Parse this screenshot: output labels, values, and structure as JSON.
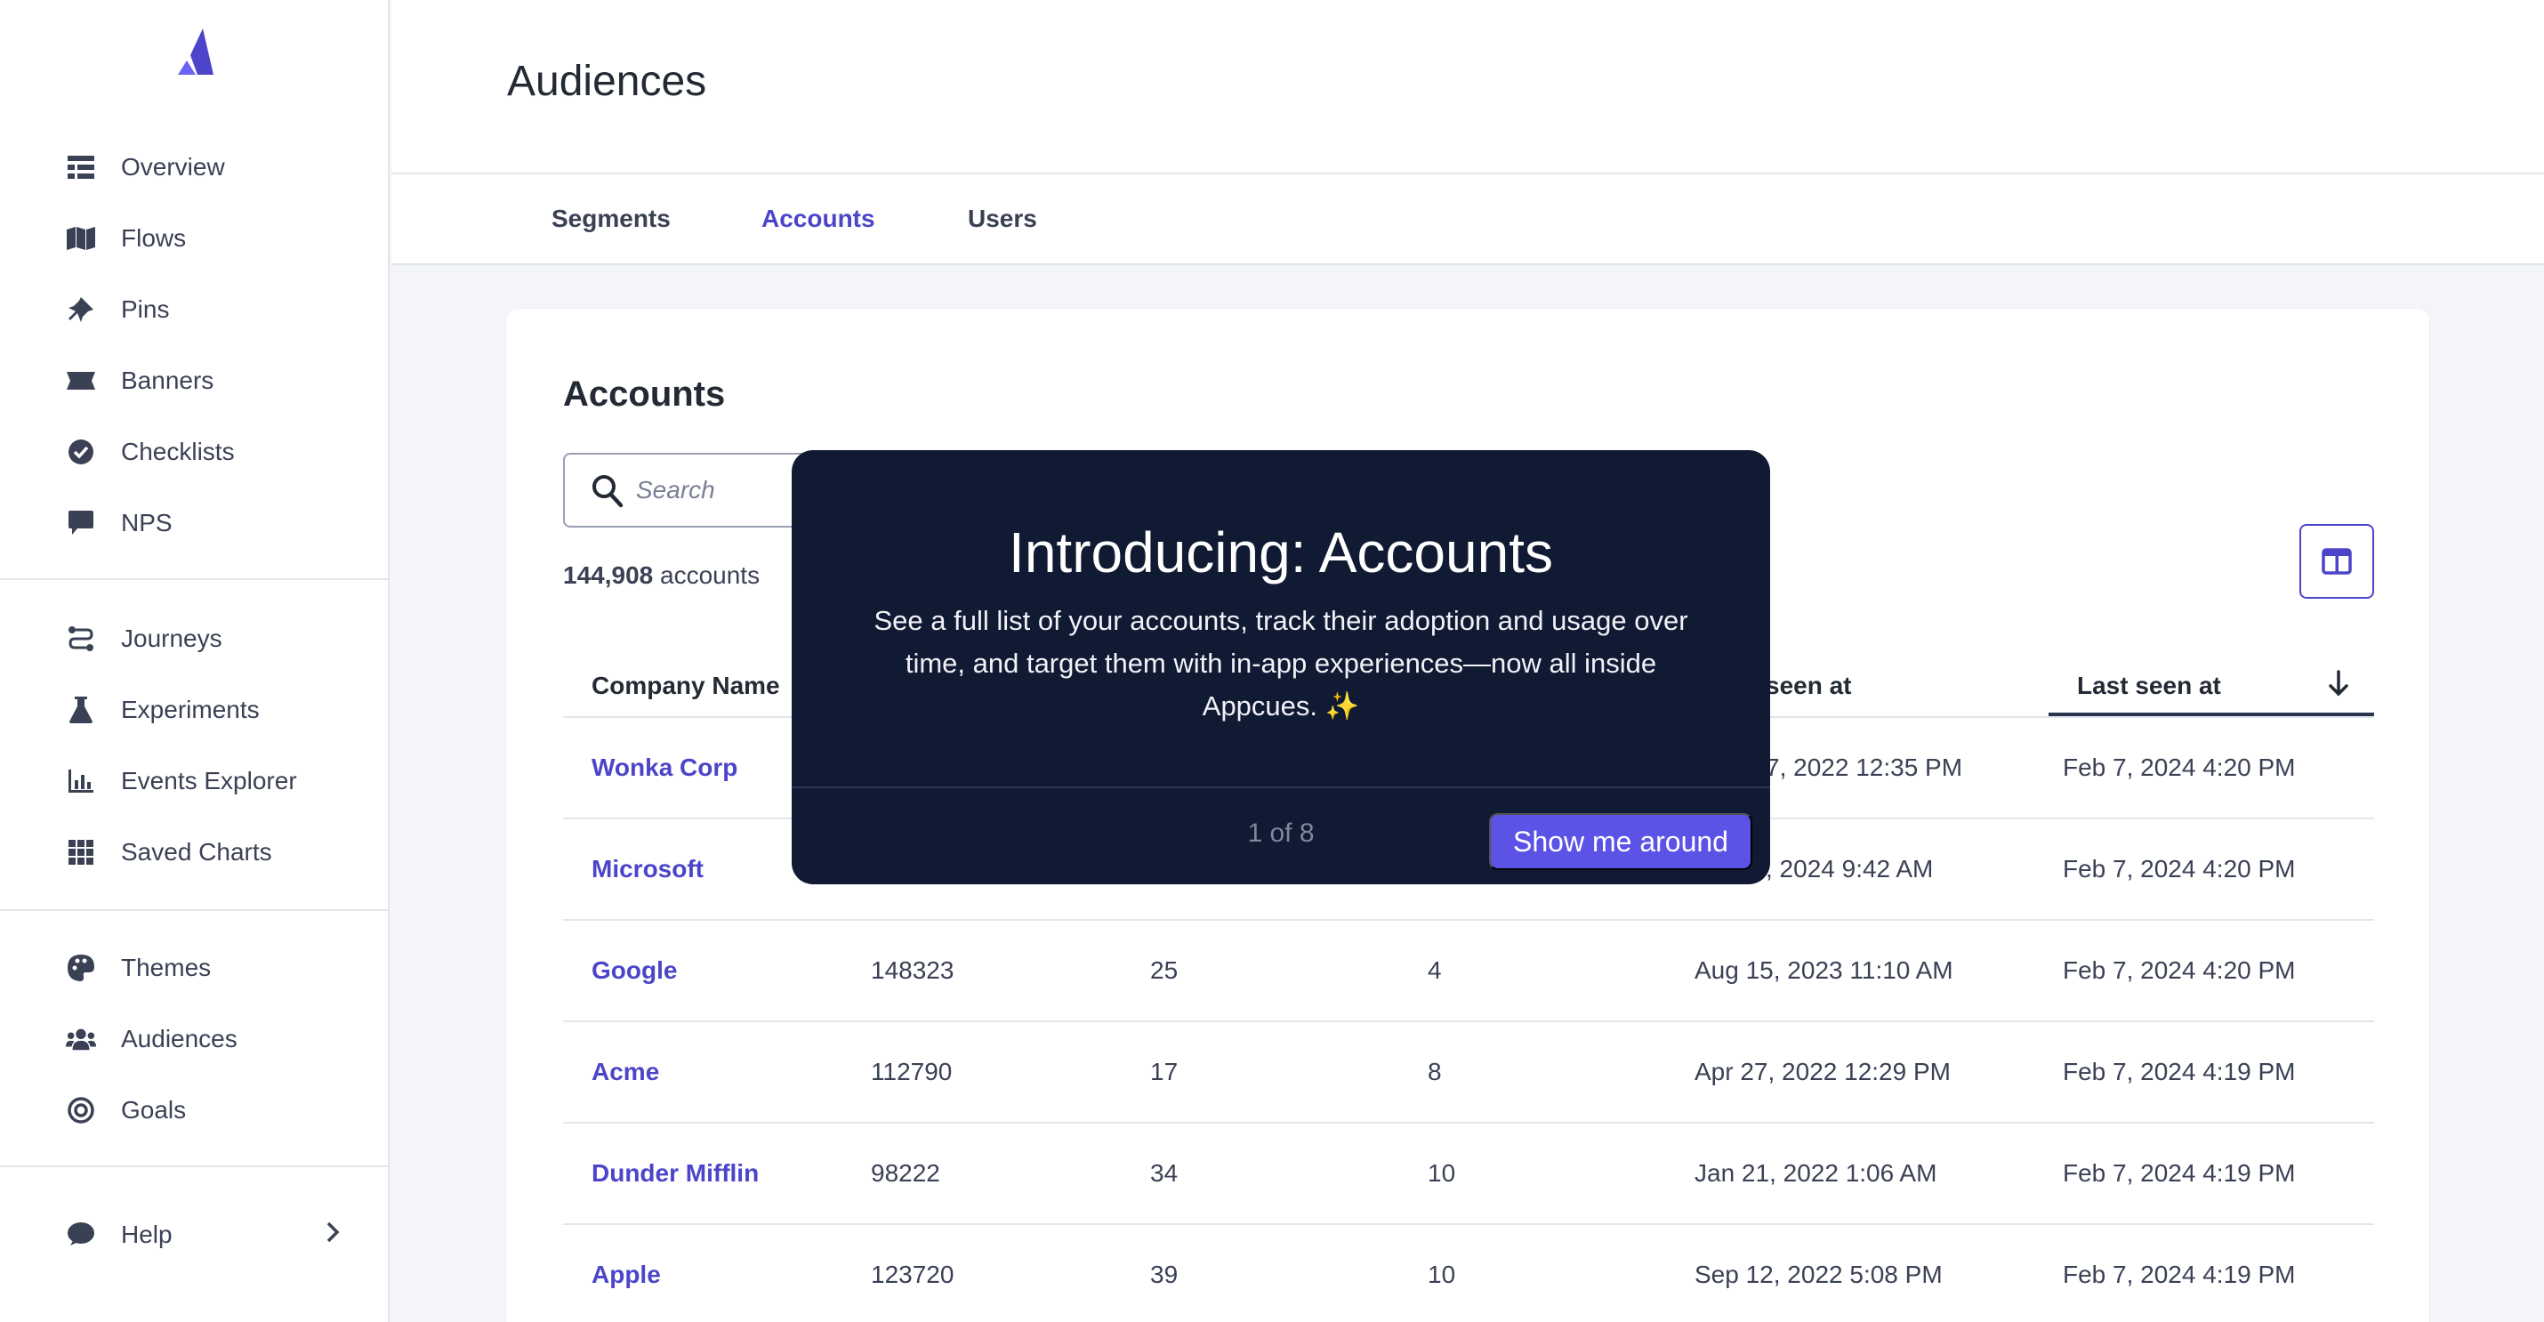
{
  "app": {
    "accent": "#4c45c9",
    "cta_color": "#5b52e6"
  },
  "sidebar": {
    "logo": "appcues-logo",
    "items": [
      {
        "label": "Overview",
        "icon": "table-icon"
      },
      {
        "label": "Flows",
        "icon": "map-icon"
      },
      {
        "label": "Pins",
        "icon": "pin-icon"
      },
      {
        "label": "Banners",
        "icon": "banner-icon"
      },
      {
        "label": "Checklists",
        "icon": "check-circle-icon"
      },
      {
        "label": "NPS",
        "icon": "chat-icon"
      },
      {
        "label": "Journeys",
        "icon": "journey-icon"
      },
      {
        "label": "Experiments",
        "icon": "flask-icon"
      },
      {
        "label": "Events Explorer",
        "icon": "bar-chart-icon"
      },
      {
        "label": "Saved Charts",
        "icon": "grid-icon"
      },
      {
        "label": "Themes",
        "icon": "palette-icon"
      },
      {
        "label": "Audiences",
        "icon": "users-icon"
      },
      {
        "label": "Goals",
        "icon": "target-icon"
      },
      {
        "label": "Help",
        "icon": "comment-icon"
      }
    ]
  },
  "header": {
    "title": "Audiences"
  },
  "tabs": [
    {
      "label": "Segments"
    },
    {
      "label": "Accounts"
    },
    {
      "label": "Users"
    }
  ],
  "main": {
    "title": "Accounts",
    "search_placeholder": "Search",
    "count_number": "144,908",
    "count_suffix": " accounts",
    "columns": [
      "Company Name",
      "",
      "",
      "",
      "seen at",
      "Last seen at"
    ],
    "rows": [
      {
        "name": "Wonka Corp",
        "c2": "",
        "c3": "",
        "c4": "",
        "first_seen": "7, 2022 12:35 PM",
        "last_seen": "Feb 7, 2024 4:20 PM"
      },
      {
        "name": "Microsoft",
        "c2": "",
        "c3": "",
        "c4": "",
        "first_seen": ", 2024 9:42 AM",
        "last_seen": "Feb 7, 2024 4:20 PM"
      },
      {
        "name": "Google",
        "c2": "148323",
        "c3": "25",
        "c4": "4",
        "first_seen": "Aug 15, 2023 11:10 AM",
        "last_seen": "Feb 7, 2024 4:20 PM"
      },
      {
        "name": "Acme",
        "c2": "112790",
        "c3": "17",
        "c4": "8",
        "first_seen": "Apr 27, 2022 12:29 PM",
        "last_seen": "Feb 7, 2024 4:19 PM"
      },
      {
        "name": "Dunder Mifflin",
        "c2": "98222",
        "c3": "34",
        "c4": "10",
        "first_seen": "Jan 21, 2022 1:06 AM",
        "last_seen": "Feb 7, 2024 4:19 PM"
      },
      {
        "name": "Apple",
        "c2": "123720",
        "c3": "39",
        "c4": "10",
        "first_seen": "Sep 12, 2022 5:08 PM",
        "last_seen": "Feb 7, 2024 4:19 PM"
      }
    ]
  },
  "modal": {
    "title": "Introducing: Accounts",
    "body": "See a full list of your accounts, track their adoption and usage over time, and target them with in-app experiences—now all inside Appcues. ✨",
    "step": "1 of 8",
    "cta": "Show me around"
  }
}
